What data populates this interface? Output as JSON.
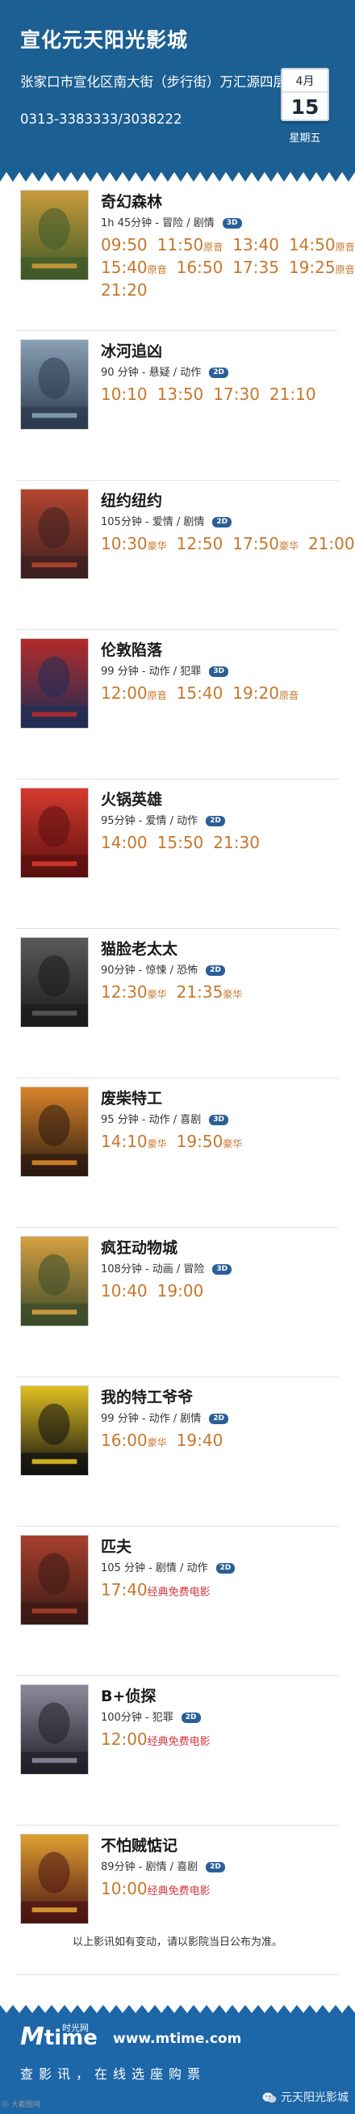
{
  "header": {
    "title": "宣化元天阳光影城",
    "address": "张家口市宣化区南大街（步行街）万汇源四层",
    "phone": "0313-3383333/3038222",
    "month": "4月",
    "day": "15",
    "weekday": "星期五"
  },
  "movies": [
    {
      "title": "奇幻森林",
      "meta": "1h 45分钟 - 冒险 / 剧情",
      "format": "3D",
      "rows": [
        [
          {
            "t": "09:50"
          },
          {
            "t": "11:50",
            "note": "原音"
          },
          {
            "t": "13:40"
          },
          {
            "t": "14:50",
            "note": "原音"
          }
        ],
        [
          {
            "t": "15:40",
            "note": "原音"
          },
          {
            "t": "16:50"
          },
          {
            "t": "17:35"
          },
          {
            "t": "19:25",
            "note": "原音"
          }
        ],
        [
          {
            "t": "21:20"
          }
        ]
      ]
    },
    {
      "title": "冰河追凶",
      "meta": "90 分钟 - 悬疑 / 动作",
      "format": "2D",
      "rows": [
        [
          {
            "t": "10:10"
          },
          {
            "t": "13:50"
          },
          {
            "t": "17:30"
          },
          {
            "t": "21:10"
          }
        ]
      ]
    },
    {
      "title": "纽约纽约",
      "meta": "105分钟 - 爱情 / 剧情",
      "format": "2D",
      "rows": [
        [
          {
            "t": "10:30",
            "note": "豪华"
          },
          {
            "t": "12:50"
          },
          {
            "t": "17:50",
            "note": "豪华"
          },
          {
            "t": "21:00"
          }
        ]
      ]
    },
    {
      "title": "伦敦陷落",
      "meta": "99 分钟 - 动作 / 犯罪",
      "format": "3D",
      "rows": [
        [
          {
            "t": "12:00",
            "note": "原音"
          },
          {
            "t": "15:40"
          },
          {
            "t": "19:20",
            "note": "原音"
          }
        ]
      ]
    },
    {
      "title": "火锅英雄",
      "meta": "95分钟 - 爱情 / 动作",
      "format": "2D",
      "rows": [
        [
          {
            "t": "14:00"
          },
          {
            "t": "15:50"
          },
          {
            "t": "21:30"
          }
        ]
      ]
    },
    {
      "title": "猫脸老太太",
      "meta": "90分钟 - 惊悚 / 恐怖",
      "format": "2D",
      "rows": [
        [
          {
            "t": "12:30",
            "note": "豪华"
          },
          {
            "t": "21:35",
            "note": "豪华"
          }
        ]
      ]
    },
    {
      "title": "废柴特工",
      "meta": "95 分钟 - 动作 / 喜剧",
      "format": "3D",
      "rows": [
        [
          {
            "t": "14:10",
            "note": "豪华"
          },
          {
            "t": "19:50",
            "note": "豪华"
          }
        ]
      ]
    },
    {
      "title": "疯狂动物城",
      "meta": "108分钟 - 动画 / 冒险",
      "format": "3D",
      "rows": [
        [
          {
            "t": "10:40"
          },
          {
            "t": "19:00"
          }
        ]
      ]
    },
    {
      "title": "我的特工爷爷",
      "meta": "99 分钟 - 动作 / 剧情",
      "format": "2D",
      "rows": [
        [
          {
            "t": "16:00",
            "note": "豪华"
          },
          {
            "t": "19:40"
          }
        ]
      ]
    },
    {
      "title": "匹夫",
      "meta": "105 分钟 - 剧情 / 动作",
      "format": "2D",
      "rows": [
        [
          {
            "t": "17:40",
            "tag": "经典免费电影"
          }
        ]
      ]
    },
    {
      "title": "B+侦探",
      "meta": "100分钟 - 犯罪",
      "format": "2D",
      "rows": [
        [
          {
            "t": "12:00",
            "tag": "经典免费电影"
          }
        ]
      ]
    },
    {
      "title": "不怕贼惦记",
      "meta": "89分钟 - 剧情 / 喜剧",
      "format": "2D",
      "rows": [
        [
          {
            "t": "10:00",
            "tag": "经典免费电影"
          }
        ]
      ]
    }
  ],
  "poster_colors": [
    [
      "#3d5a2a",
      "#c99a3a"
    ],
    [
      "#2b3a4f",
      "#8aa0b5"
    ],
    [
      "#3a1f1f",
      "#b5452f"
    ],
    [
      "#1f2d55",
      "#b32b2b"
    ],
    [
      "#5a0f0f",
      "#d63a2e"
    ],
    [
      "#1a1a1a",
      "#5a5a5a"
    ],
    [
      "#2b1a10",
      "#d9852a"
    ],
    [
      "#3a4a2a",
      "#d6a040"
    ],
    [
      "#111111",
      "#e0c020"
    ],
    [
      "#3a1a14",
      "#a8402e"
    ],
    [
      "#20202a",
      "#8a8a9a"
    ],
    [
      "#4a1414",
      "#e0a030"
    ]
  ],
  "footer": {
    "note": "以上影讯如有变动，请以影院当日公布为准。",
    "logo_m": "M",
    "logo_time": "time",
    "logo_cn": "时光网",
    "url": "www.mtime.com",
    "slogan": "查影讯，在线选座购票",
    "credit": "元天阳光影城",
    "corner": "⑫ 大截图网"
  },
  "colors": {
    "header_bg": "#1c5f93",
    "time": "#c7772b",
    "tag": "#d2343c",
    "badge": "#2a5f97",
    "footer_bg": "#1d66a8"
  }
}
